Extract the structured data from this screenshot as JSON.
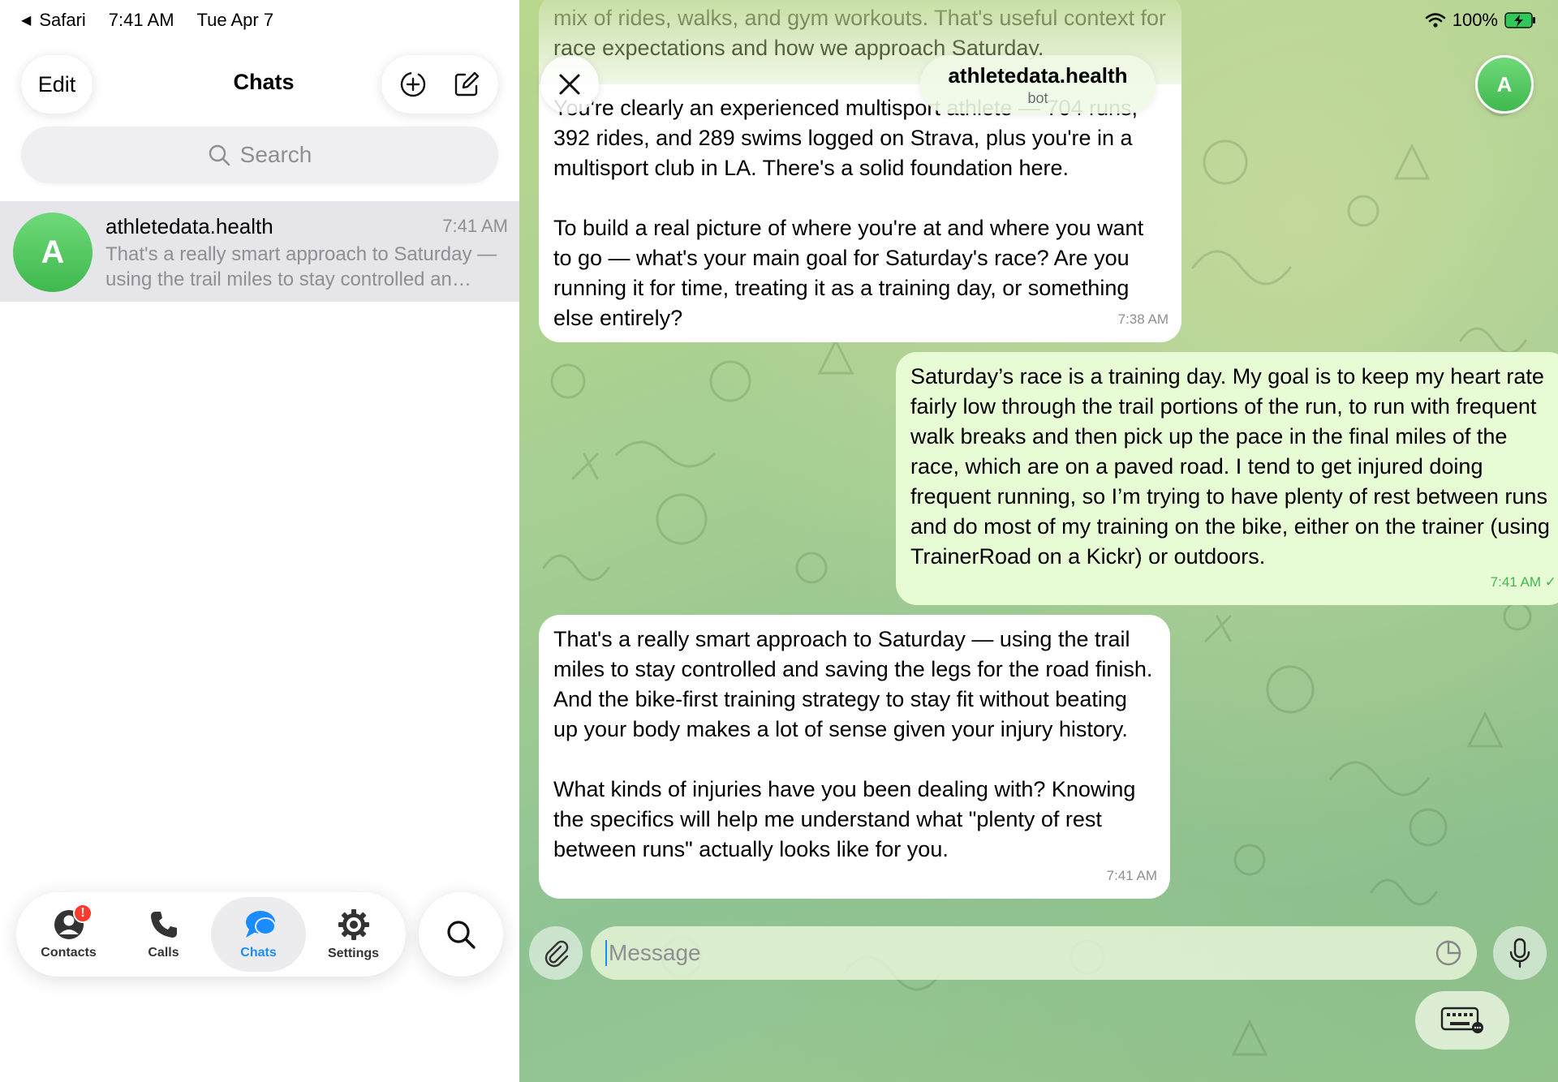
{
  "status": {
    "back_app": "Safari",
    "time": "7:41 AM",
    "date": "Tue Apr 7",
    "battery": "100%"
  },
  "sidebar": {
    "edit_label": "Edit",
    "title": "Chats",
    "search_placeholder": "Search",
    "chats": [
      {
        "avatar_letter": "A",
        "name": "athletedata.health",
        "time": "7:41 AM",
        "preview": "That's a really smart approach to Saturday — using the trail miles to stay controlled an…"
      }
    ]
  },
  "tabbar": {
    "tabs": [
      {
        "label": "Contacts",
        "icon": "person-circle-icon",
        "badge": "!"
      },
      {
        "label": "Calls",
        "icon": "phone-icon"
      },
      {
        "label": "Chats",
        "icon": "chat-bubbles-icon",
        "active": true
      },
      {
        "label": "Settings",
        "icon": "gear-icon"
      }
    ]
  },
  "conversation": {
    "title": "athletedata.health",
    "subtitle": "bot",
    "avatar_letter": "A",
    "messages": [
      {
        "direction": "incoming",
        "text": "mix of rides, walks, and gym workouts. That's useful context for race expectations and how we approach Saturday.\n\nYou're clearly an experienced multisport athlete — 704 runs, 392 rides, and 289 swims logged on Strava, plus you're in a multisport club in LA. There's a solid foundation here.\n\nTo build a real picture of where you're at and where you want to go — what's your main goal for Saturday's race? Are you running it for time, treating it as a training day, or something else entirely?",
        "time": "7:38 AM"
      },
      {
        "direction": "outgoing",
        "text": "Saturday’s race is a training day. My goal is to keep my heart rate fairly low through the trail portions of the run, to run with frequent walk breaks and then pick up the pace in the final miles of the race, which are on a paved road. I tend to get injured doing frequent running, so I’m trying to have plenty of rest between runs and do most of my training on the bike, either on the trainer (using TrainerRoad on a Kickr) or outdoors.",
        "time": "7:41 AM"
      },
      {
        "direction": "incoming",
        "text": "That's a really smart approach to Saturday — using the trail miles to stay controlled and saving the legs for the road finish. And the bike-first training strategy to stay fit without beating up your body makes a lot of sense given your injury history.\n\nWhat kinds of injuries have you been dealing with? Knowing the specifics will help me understand what \"plenty of rest between runs\" actually looks like for you.",
        "time": "7:41 AM"
      }
    ],
    "input_placeholder": "Message"
  },
  "colors": {
    "accent": "#1a8cff",
    "avatar_green": "#4cc95a",
    "outgoing_bubble": "#e7fbd4",
    "badge_red": "#ff3b30"
  }
}
